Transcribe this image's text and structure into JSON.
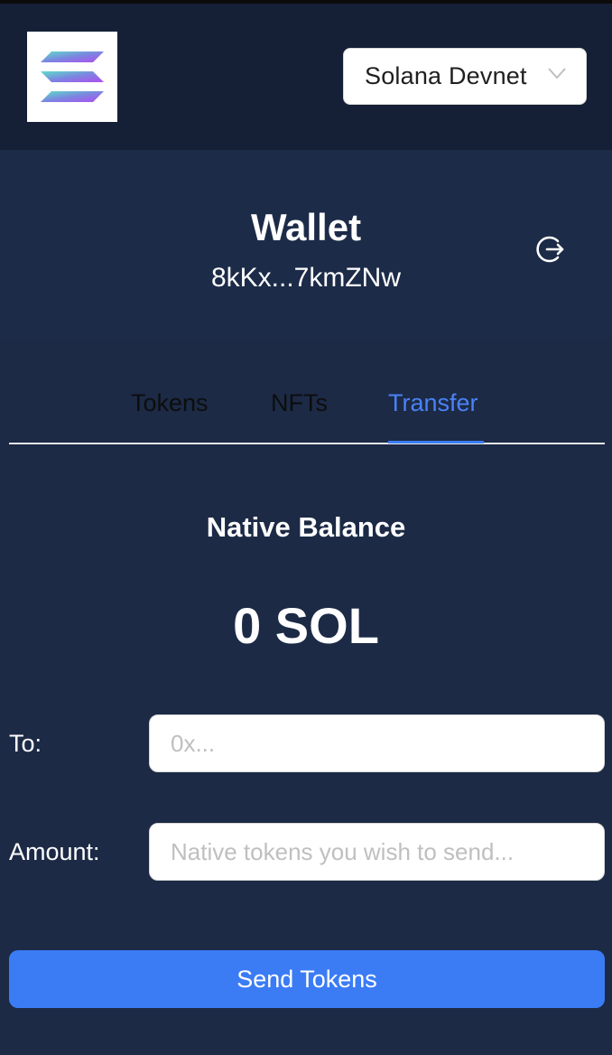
{
  "header": {
    "logo_icon": "solana-logo-icon",
    "network": {
      "selected": "Solana Devnet",
      "chevron_icon": "chevron-down-icon"
    }
  },
  "wallet": {
    "title": "Wallet",
    "address": "8kKx...7kmZNw",
    "logout_icon": "logout-icon"
  },
  "tabs": [
    {
      "label": "Tokens",
      "active": false
    },
    {
      "label": "NFTs",
      "active": false
    },
    {
      "label": "Transfer",
      "active": true
    }
  ],
  "transfer": {
    "balance_title": "Native Balance",
    "balance_value": "0 SOL",
    "to_label": "To:",
    "to_placeholder": "0x...",
    "amount_label": "Amount:",
    "amount_placeholder": "Native tokens you wish to send...",
    "send_label": "Send Tokens"
  },
  "colors": {
    "header_bg": "#152036",
    "page_bg": "#1c2a46",
    "accent": "#3b7cf5",
    "active_tab": "#4a82f6"
  }
}
